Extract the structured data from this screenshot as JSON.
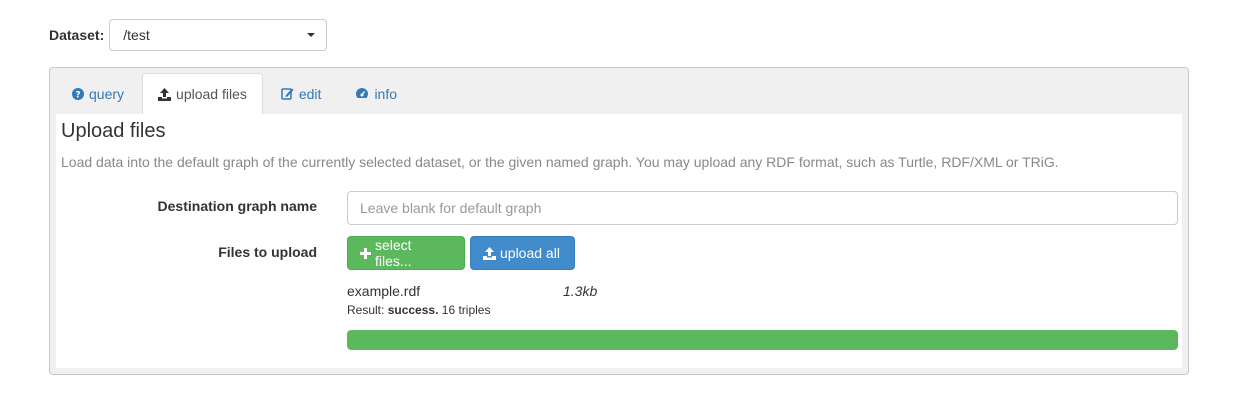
{
  "dataset": {
    "label": "Dataset:",
    "selected": "/test"
  },
  "tabs": [
    {
      "label": "query",
      "icon": "question-circle-icon"
    },
    {
      "label": "upload files",
      "icon": "upload-icon"
    },
    {
      "label": "edit",
      "icon": "edit-icon"
    },
    {
      "label": "info",
      "icon": "dashboard-icon"
    }
  ],
  "active_tab": "upload files",
  "upload": {
    "heading": "Upload files",
    "description": "Load data into the default graph of the currently selected dataset, or the given named graph. You may upload any RDF format, such as Turtle, RDF/XML or TRiG.",
    "destination_label": "Destination graph name",
    "destination_value": "",
    "destination_placeholder": "Leave blank for default graph",
    "files_label": "Files to upload",
    "select_files_label": "select files...",
    "upload_all_label": "upload all"
  },
  "file": {
    "name": "example.rdf",
    "size": "1.3kb",
    "result_prefix": "Result:",
    "result_status": "success.",
    "result_detail": "16 triples",
    "progress_percent": 100
  },
  "colors": {
    "link": "#337ab7",
    "success": "#5cb85c",
    "primary": "#428bca"
  }
}
